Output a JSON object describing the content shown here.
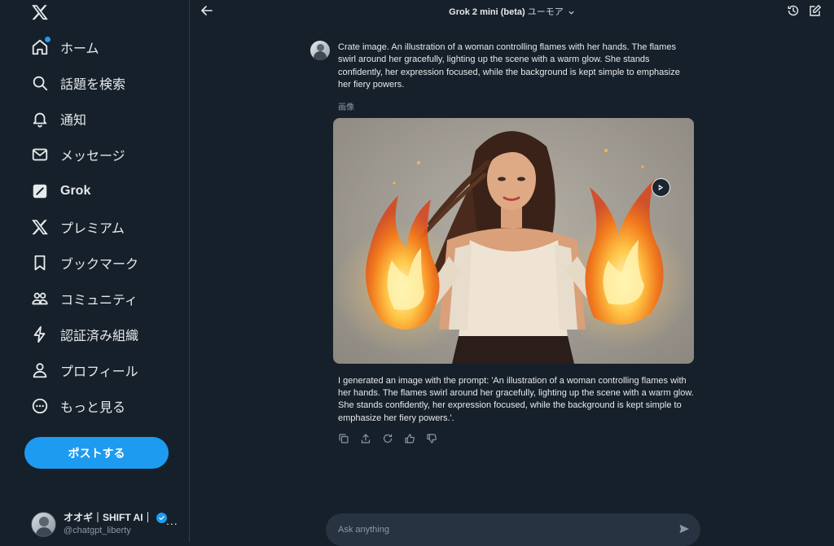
{
  "sidebar": {
    "logo_icon": "x-logo-icon",
    "items": [
      {
        "label": "ホーム",
        "icon": "home-icon"
      },
      {
        "label": "話題を検索",
        "icon": "search-icon"
      },
      {
        "label": "通知",
        "icon": "bell-icon"
      },
      {
        "label": "メッセージ",
        "icon": "mail-icon"
      },
      {
        "label": "Grok",
        "icon": "grok-icon"
      },
      {
        "label": "プレミアム",
        "icon": "x-premium-icon"
      },
      {
        "label": "ブックマーク",
        "icon": "bookmark-icon"
      },
      {
        "label": "コミュニティ",
        "icon": "community-icon"
      },
      {
        "label": "認証済み組織",
        "icon": "lightning-icon"
      },
      {
        "label": "プロフィール",
        "icon": "person-icon"
      },
      {
        "label": "もっと見る",
        "icon": "more-circle-icon"
      }
    ],
    "post_button": "ポストする",
    "account": {
      "name": "オオギ｜SHIFT AI｜",
      "handle": "@chatgpt_liberty",
      "more": "..."
    }
  },
  "header": {
    "model": "Grok 2 mini (beta)",
    "mode": "ユーモア"
  },
  "chat": {
    "user_message": "Crate image. An illustration of a woman controlling flames with her hands. The flames swirl around her gracefully, lighting up the scene with a warm glow. She stands confidently, her expression focused, while the background is kept simple to emphasize her fiery powers.",
    "image_label": "画像",
    "bot_message": "I generated an image with the prompt: 'An illustration of a woman controlling flames with her hands. The flames swirl around her gracefully, lighting up the scene with a warm glow. She stands confidently, her expression focused, while the background is kept simple to emphasize her fiery powers.'."
  },
  "composer": {
    "placeholder": "Ask anything"
  },
  "colors": {
    "accent": "#1d9bf0",
    "background": "#15202b",
    "composer": "#273340"
  }
}
